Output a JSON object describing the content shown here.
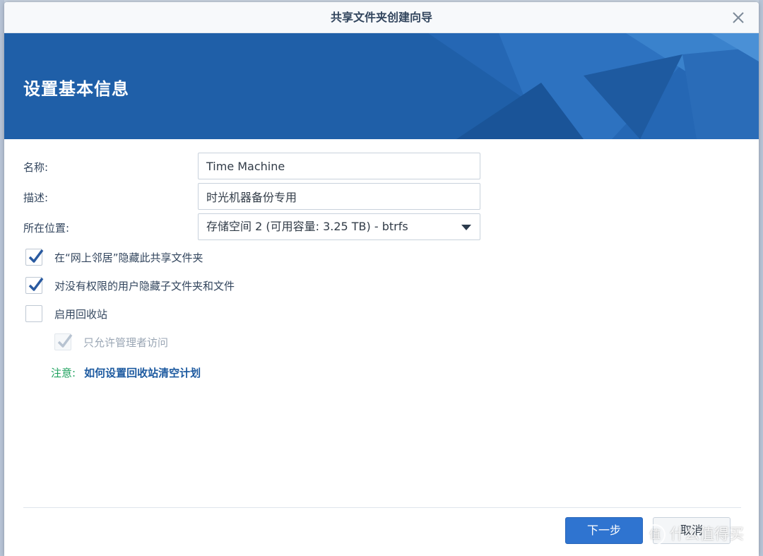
{
  "window": {
    "title": "共享文件夹创建向导"
  },
  "banner": {
    "heading": "设置基本信息"
  },
  "form": {
    "name_label": "名称:",
    "name_value": "Time Machine",
    "description_label": "描述:",
    "description_value": "时光机器备份专用",
    "location_label": "所在位置:",
    "location_value": "存储空间 2 (可用容量:  3.25 TB) - btrfs"
  },
  "options": [
    {
      "label": "在“网上邻居”隐藏此共享文件夹",
      "checked": true,
      "enabled": true
    },
    {
      "label": "对没有权限的用户隐藏子文件夹和文件",
      "checked": true,
      "enabled": true
    },
    {
      "label": "启用回收站",
      "checked": false,
      "enabled": true
    },
    {
      "label": "只允许管理者访问",
      "checked": true,
      "enabled": false
    }
  ],
  "note": {
    "label": "注意:",
    "link": "如何设置回收站清空计划"
  },
  "buttons": {
    "next": "下一步",
    "cancel": "取消"
  },
  "watermark": {
    "icon_text": "值",
    "text": "什么值得买"
  },
  "colors": {
    "banner": "#1f5fa8",
    "primary_button": "#2f74d0",
    "check": "#2a5aa0",
    "note_label": "#1ba05b",
    "link": "#1d5aa0"
  },
  "icons": {
    "close": "close-icon",
    "dropdown": "chevron-down-icon",
    "check": "check-icon"
  }
}
